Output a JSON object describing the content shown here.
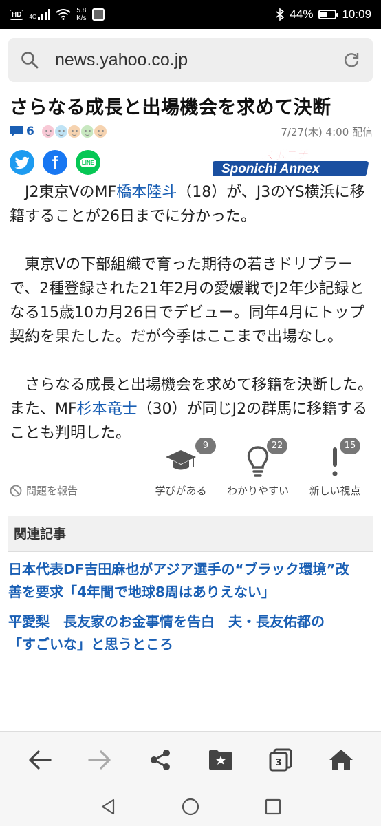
{
  "status_bar": {
    "network_type": "HD",
    "signal": "4G",
    "net_speed_value": "5.8",
    "net_speed_unit": "K/s",
    "battery": "44%",
    "battery_level": 0.44,
    "time": "10:09"
  },
  "browser": {
    "url": "news.yahoo.co.jp",
    "tab_count": "3"
  },
  "article": {
    "title": "さらなる成長と出場機会を求めて決断",
    "comment_count": "6",
    "datetime": "7/27(木) 4:00 配信",
    "source": "Sponichi Annex",
    "source_kana": "スポニチ",
    "share": {
      "line_label": "LINE"
    },
    "paragraphs": [
      {
        "parts": [
          "J2東京VのMF",
          "橋本陸斗",
          "（18）が、J3のYS横浜に移籍することが26日までに分かった。"
        ]
      },
      {
        "text": "東京Vの下部組織で育った期待の若きドリブラーで、2種登録された21年2月の愛媛戦でJ2年少記録となる15歳10カ月26日でデビュー。同年4月にトップ契約を果たした。だが今季はここまで出場なし。"
      },
      {
        "parts": [
          "さらなる成長と出場機会を求めて移籍を決断した。また、MF",
          "杉本竜士",
          "（30）が同じJ2の群馬に移籍することも判明した。"
        ]
      }
    ]
  },
  "reactions": {
    "report": "問題を報告",
    "items": [
      {
        "label": "学びがある",
        "count": "9",
        "icon": "graduation-cap-icon"
      },
      {
        "label": "わかりやすい",
        "count": "22",
        "icon": "lightbulb-icon"
      },
      {
        "label": "新しい視点",
        "count": "15",
        "icon": "exclamation-icon"
      }
    ]
  },
  "related": {
    "header": "関連記事",
    "items": [
      {
        "line1": "日本代表DF吉田麻也がアジア選手の“ブラック環境”改",
        "line2": "善を要求「4年間で地球8周はありえない」"
      },
      {
        "line1": "平愛梨　長友家のお金事情を告白　夫・長友佑都の",
        "line2": "「すごいな」と思うところ"
      }
    ]
  },
  "colors": {
    "link": "#1a5fb4",
    "twitter": "#1d9bf0",
    "facebook": "#1877f2",
    "line": "#06c755",
    "badge": "#777777"
  }
}
